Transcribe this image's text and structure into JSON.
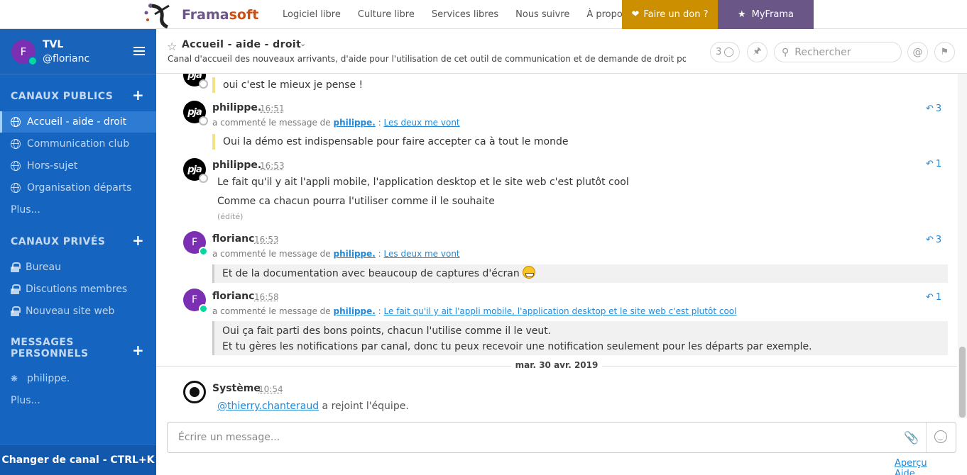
{
  "topbar": {
    "brand_a": "Frama",
    "brand_b": "soft",
    "nav": [
      "Logiciel libre",
      "Culture libre",
      "Services libres",
      "Nous suivre",
      "À propos"
    ],
    "donate": "Faire un don ?",
    "myframa": "MyFrama"
  },
  "sidebar": {
    "avatar_letter": "F",
    "team": "TVL",
    "user": "@florianc",
    "public_title": "CANAUX PUBLICS",
    "public": [
      "Accueil - aide - droit",
      "Communication club",
      "Hors-sujet",
      "Organisation départs"
    ],
    "more1": "Plus...",
    "private_title": "CANAUX PRIVÉS",
    "private": [
      "Bureau",
      "Discutions membres",
      "Nouveau site web"
    ],
    "dm_title_1": "MESSAGES",
    "dm_title_2": "PERSONNELS",
    "dm": [
      "philippe."
    ],
    "more2": "Plus...",
    "switch": "Changer de canal - CTRL+K"
  },
  "channel": {
    "name": "Accueil - aide - droit",
    "purpose": "Canal d'accueil des nouveaux arrivants, d'aide pour l'utilisation de cet outil de communication et de demande de droit pour les ca...",
    "members": "3",
    "search_placeholder": "Rechercher"
  },
  "messages": {
    "m0_quote": "oui c'est le mieux je pense !",
    "m1": {
      "author": "philippe.",
      "time": "16:51",
      "comment_prefix": "a commenté le message de",
      "comment_user": "philippe.",
      "comment_sep": ":",
      "comment_link": "Les deux me vont",
      "quote": "Oui la démo est indispensable pour faire accepter ca à tout le monde",
      "replies": "3"
    },
    "m2": {
      "author": "philippe.",
      "time": "16:53",
      "line1": "Le fait qu'il y ait l'appli mobile, l'application desktop et le site web c'est plutôt cool",
      "line2": "Comme ca chacun pourra l'utiliser comme il le souhaite",
      "edited": "(édité)",
      "replies": "1"
    },
    "m3": {
      "author": "florianc",
      "time": "16:53",
      "comment_prefix": "a commenté le message de",
      "comment_user": "philippe.",
      "comment_sep": ":",
      "comment_link": "Les deux me vont",
      "quote": "Et de la documentation avec beaucoup de captures d'écran",
      "replies": "3"
    },
    "m4": {
      "author": "florianc",
      "time": "16:58",
      "comment_prefix": "a commenté le message de",
      "comment_user": "philippe.",
      "comment_sep": ":",
      "comment_link": "Le fait qu'il y ait l'appli mobile, l'application desktop et le site web c'est plutôt cool",
      "quote1": "Oui ça fait parti des bons points, chacun l'utilise comme il le veut.",
      "quote2": "Et tu gères les notifications par canal, donc tu peux recevoir une notification seulement pour les départs par exemple.",
      "replies": "1"
    },
    "date": "mar. 30 avr. 2019",
    "sys": {
      "author": "Système",
      "time": "10:54",
      "mention": "@thierry.chanteraud",
      "text_a": "a",
      "text_b": "rejoint l'équipe."
    }
  },
  "composer": {
    "placeholder": "Écrire un message..."
  },
  "footer": {
    "preview": "Aperçu",
    "help": "Aide"
  }
}
